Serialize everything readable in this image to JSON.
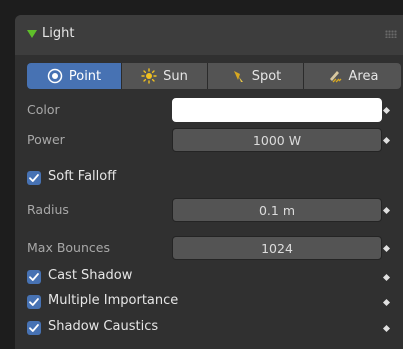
{
  "panel": {
    "title": "Light"
  },
  "light_types": [
    {
      "label": "Point",
      "icon": "point-light-icon",
      "active": true
    },
    {
      "label": "Sun",
      "icon": "sun-light-icon",
      "active": false
    },
    {
      "label": "Spot",
      "icon": "spot-light-icon",
      "active": false
    },
    {
      "label": "Area",
      "icon": "area-light-icon",
      "active": false
    }
  ],
  "properties": {
    "color_label": "Color",
    "color_value": "#ffffff",
    "power_label": "Power",
    "power_value": "1000 W",
    "soft_falloff_label": "Soft Falloff",
    "soft_falloff_checked": true,
    "radius_label": "Radius",
    "radius_value": "0.1 m",
    "max_bounces_label": "Max Bounces",
    "max_bounces_value": "1024",
    "cast_shadow_label": "Cast Shadow",
    "cast_shadow_checked": true,
    "multiple_importance_label": "Multiple Importance",
    "multiple_importance_checked": true,
    "shadow_caustics_label": "Shadow Caustics",
    "shadow_caustics_checked": true
  },
  "colors": {
    "accent": "#4772b3",
    "panel_bg": "#303030",
    "header_bg": "#3d3d3d",
    "expand_arrow": "#5fbf2a"
  }
}
